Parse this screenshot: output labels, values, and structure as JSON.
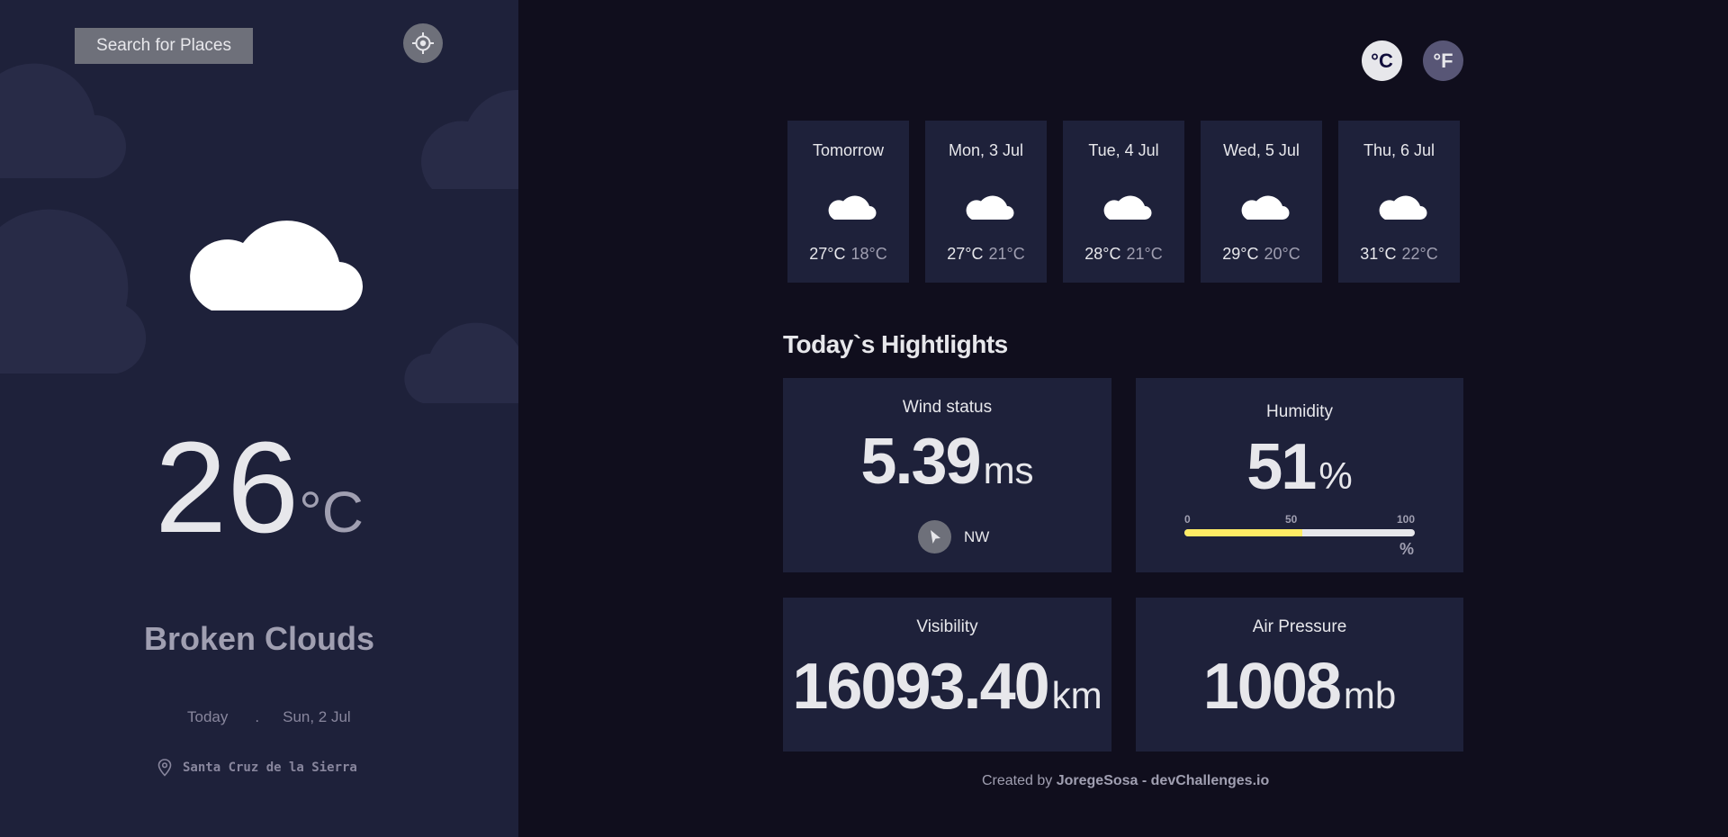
{
  "sidebar": {
    "search_label": "Search for Places",
    "current": {
      "temperature": "26",
      "unit": "°C",
      "condition": "Broken Clouds",
      "day": "Today",
      "separator": ".",
      "date": "Sun, 2 Jul",
      "location": "Santa Cruz de la Sierra"
    },
    "icons": {
      "locate": "crosshair-icon",
      "location": "map-pin-icon",
      "weather": "cloud-icon"
    }
  },
  "units": {
    "celsius": "°C",
    "fahrenheit": "°F",
    "active": "°C"
  },
  "forecast": [
    {
      "day": "Tomorrow",
      "max": "27°C",
      "min": "18°C",
      "icon": "cloud-icon"
    },
    {
      "day": "Mon, 3 Jul",
      "max": "27°C",
      "min": "21°C",
      "icon": "cloud-icon"
    },
    {
      "day": "Tue, 4 Jul",
      "max": "28°C",
      "min": "21°C",
      "icon": "cloud-icon"
    },
    {
      "day": "Wed, 5 Jul",
      "max": "29°C",
      "min": "20°C",
      "icon": "cloud-icon"
    },
    {
      "day": "Thu, 6 Jul",
      "max": "31°C",
      "min": "22°C",
      "icon": "cloud-icon"
    }
  ],
  "highlights": {
    "title": "Today`s Hightlights",
    "wind": {
      "label": "Wind status",
      "value": "5.39",
      "unit": "ms",
      "direction": "NW",
      "icon": "navigation-arrow-icon"
    },
    "humidity": {
      "label": "Humidity",
      "value": "51",
      "unit": "%",
      "scale_min": "0",
      "scale_mid": "50",
      "scale_max": "100",
      "scale_unit": "%",
      "percent": 51
    },
    "visibility": {
      "label": "Visibility",
      "value": "16093.40",
      "unit": "km"
    },
    "pressure": {
      "label": "Air Pressure",
      "value": "1008",
      "unit": "mb"
    }
  },
  "footer": {
    "prefix": "Created by ",
    "author": "JoregeSosa - devChallenges.io"
  },
  "colors": {
    "sidebar_bg": "#1e213a",
    "page_bg": "#100e1d",
    "card_bg": "#1e213a",
    "text_primary": "#e7e7eb",
    "text_secondary": "#a09fb1",
    "accent_yellow": "#ffec65",
    "button_gray": "#6e707a"
  }
}
